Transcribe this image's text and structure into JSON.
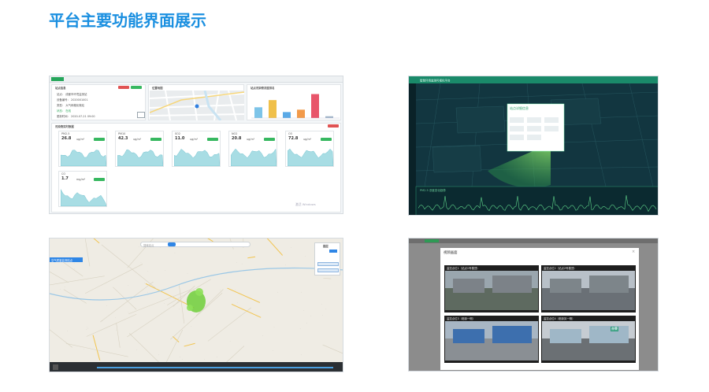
{
  "heading": "平台主要功能界面展示",
  "panel1": {
    "sections": {
      "site": "站点信息",
      "map": "位置地图",
      "bar": "站点污染物浓度排名",
      "realtime": "污染物实时数据"
    },
    "info_lines": [
      "站点： 成都市环境监测站",
      "设备编号： 2020001001",
      "类型： 大气网格化微站",
      "状态： 在线",
      "更新时间： 2020-07-21 09:00"
    ],
    "gauges": [
      {
        "name": "PM2.5",
        "value": "26.8",
        "unit": "ug/m³"
      },
      {
        "name": "PM10",
        "value": "42.3",
        "unit": "ug/m³"
      },
      {
        "name": "SO2",
        "value": "11.0",
        "unit": "ug/m³"
      },
      {
        "name": "NO2",
        "value": "20.8",
        "unit": "ug/m³"
      },
      {
        "name": "O3",
        "value": "72.8",
        "unit": "ug/m³"
      },
      {
        "name": "CO",
        "value": "1.7",
        "unit": "mg/m³"
      }
    ],
    "bar_values": [
      18,
      30,
      10,
      14,
      40,
      3
    ],
    "bar_colors": [
      "#7dc4e8",
      "#f0c04a",
      "#5aa9e6",
      "#f29a4a",
      "#e8556a",
      "#9fb3c8"
    ],
    "watermark": "激活 Windows"
  },
  "panel2": {
    "app_title": "智慧环境监测可视化平台",
    "popup_title": "站点详细信息",
    "bottom_label": "PM2.5 浓度变化趋势"
  },
  "panel3": {
    "search_placeholder": "搜索站点",
    "tabs": [
      "AQI",
      "PM2.5",
      "PM10",
      "SO2",
      "NO2",
      "O3",
      "CO"
    ],
    "side_label": "空气质量监测站点",
    "legend_title": "图层"
  },
  "panel4": {
    "dialog_title": "视频画面",
    "cameras": [
      "监控点位1（站点1号楼顶）",
      "监控点位2（站点2号楼顶）",
      "监控点位3（临街一侧）",
      "监控点位4（临街另一侧）"
    ],
    "sign_text": "亦荣"
  }
}
